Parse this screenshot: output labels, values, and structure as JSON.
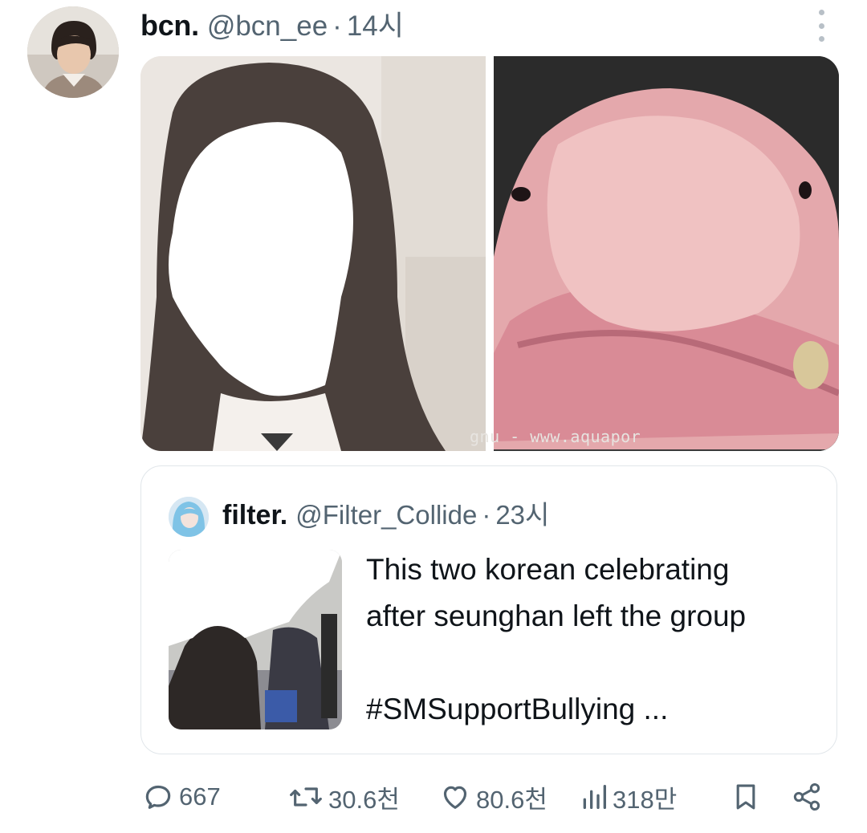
{
  "tweet": {
    "display_name": "bcn.",
    "handle": "@bcn_ee",
    "separator": "·",
    "time": "14시",
    "avatar_icon": "user-avatar",
    "more_icon": "more-vertical-icon"
  },
  "media": {
    "watermark": "gnu - www.aquapor"
  },
  "quoted_tweet": {
    "display_name": "filter.",
    "handle": "@Filter_Collide",
    "separator": "·",
    "time": "23시",
    "text_line1": "This two korean celebrating",
    "text_line2": "after seunghan left the group",
    "hashtag": "#SMSupportBullying ..."
  },
  "actions": {
    "replies": "667",
    "retweets": "30.6천",
    "likes": "80.6천",
    "views": "318만",
    "reply_icon": "reply-icon",
    "retweet_icon": "retweet-icon",
    "like_icon": "heart-icon",
    "views_icon": "views-icon",
    "bookmark_icon": "bookmark-icon",
    "share_icon": "share-icon"
  },
  "colors": {
    "text": "#0f1419",
    "secondary": "#536471",
    "border": "#e1e6ea"
  }
}
